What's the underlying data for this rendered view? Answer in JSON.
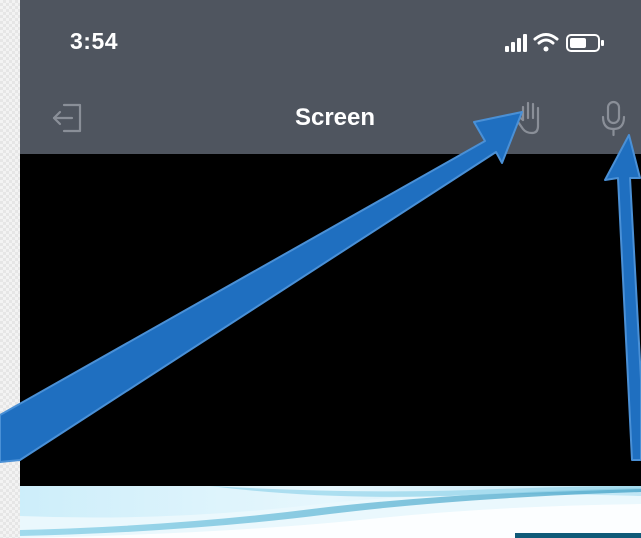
{
  "status_bar": {
    "time": "3:54",
    "icons": [
      "cellular-signal-icon",
      "wifi-icon",
      "battery-icon"
    ]
  },
  "nav_bar": {
    "title": "Screen",
    "left_icon": "leave-icon",
    "right_icons": [
      "raise-hand-icon",
      "microphone-icon"
    ]
  },
  "colors": {
    "bar_background": "#4f555f",
    "icon_muted": "#8a8f98",
    "video_background": "#000000",
    "annotation_arrow": "#1f6fc0"
  },
  "annotations": {
    "arrow_icons": [
      "arrow-to-raise-hand-icon",
      "arrow-to-microphone-icon"
    ]
  }
}
